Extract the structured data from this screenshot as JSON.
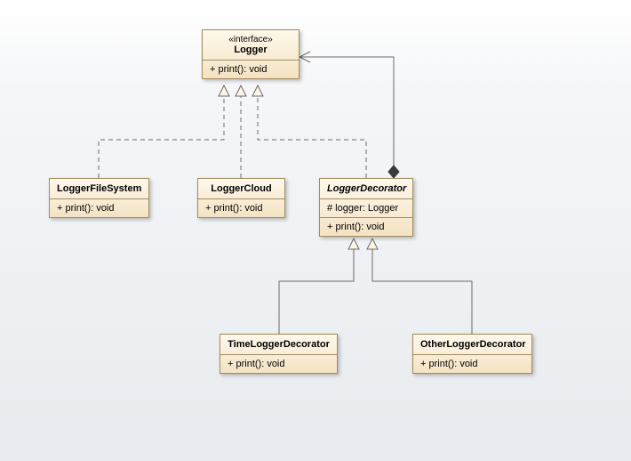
{
  "logger": {
    "stereotype": "«interface»",
    "name": "Logger",
    "method": "+   print(): void"
  },
  "loggerFileSystem": {
    "name": "LoggerFileSystem",
    "method": "+   print(): void"
  },
  "loggerCloud": {
    "name": "LoggerCloud",
    "method": "+   print(): void"
  },
  "loggerDecorator": {
    "name": "LoggerDecorator",
    "attr": "#   logger: Logger",
    "method": "+   print(): void"
  },
  "timeLoggerDecorator": {
    "name": "TimeLoggerDecorator",
    "method": "+   print(): void"
  },
  "otherLoggerDecorator": {
    "name": "OtherLoggerDecorator",
    "method": "+   print(): void"
  }
}
